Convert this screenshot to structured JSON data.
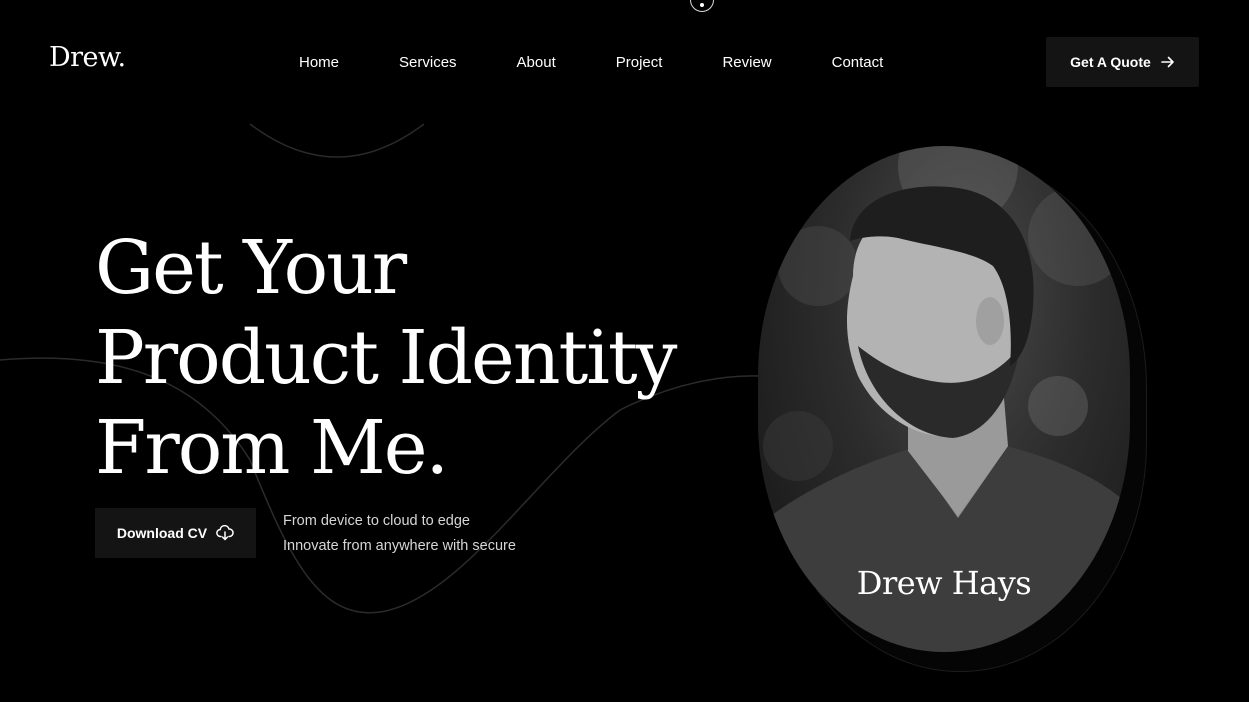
{
  "brand": {
    "logo": "Drew."
  },
  "nav": {
    "items": [
      {
        "label": "Home"
      },
      {
        "label": "Services"
      },
      {
        "label": "About"
      },
      {
        "label": "Project"
      },
      {
        "label": "Review"
      },
      {
        "label": "Contact"
      }
    ]
  },
  "header": {
    "quote_button": "Get A Quote",
    "quote_icon": "arrow-right-icon"
  },
  "hero": {
    "headline_lines": [
      "Get Your",
      "Product Identity",
      "From Me."
    ],
    "download_button": "Download CV",
    "download_icon": "cloud-download-icon",
    "tagline_lines": [
      "From device to cloud to edge",
      "Innovate from anywhere with secure"
    ]
  },
  "portrait": {
    "name": "Drew Hays"
  },
  "colors": {
    "background": "#000000",
    "button_bg": "#141414",
    "text": "#ffffff"
  }
}
